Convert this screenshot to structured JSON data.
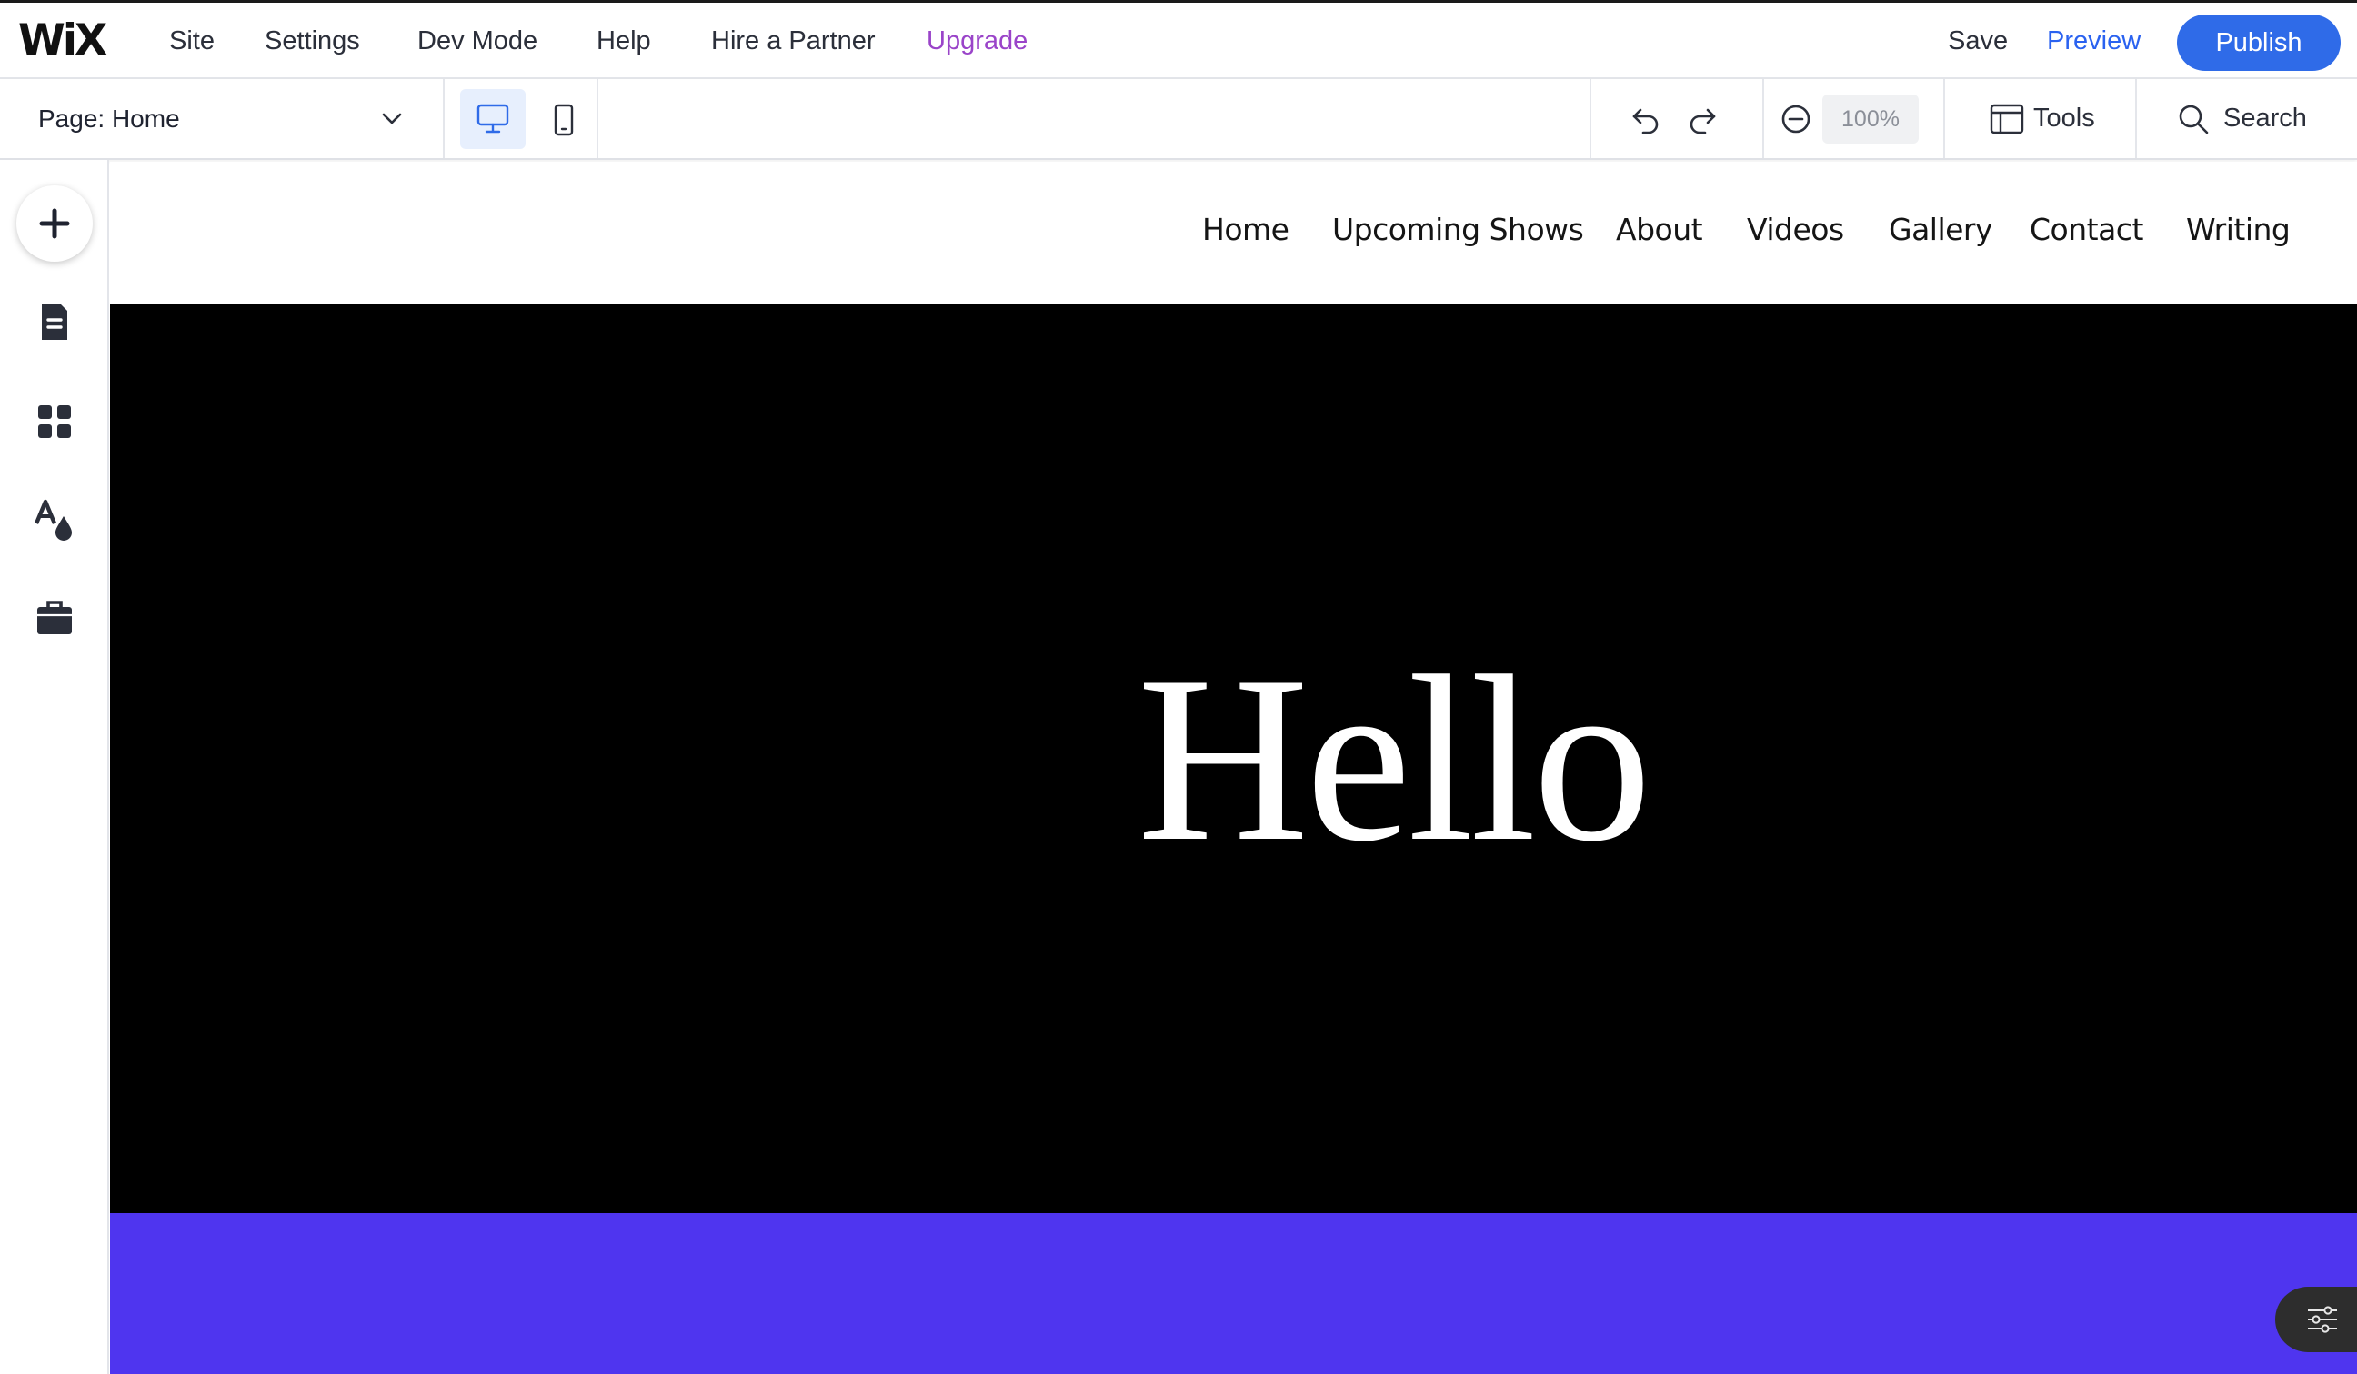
{
  "topbar": {
    "logo": "WiX",
    "menu": [
      "Site",
      "Settings",
      "Dev Mode",
      "Help",
      "Hire a Partner"
    ],
    "upgrade": "Upgrade",
    "save": "Save",
    "preview": "Preview",
    "publish": "Publish"
  },
  "toolbar": {
    "page_label": "Page:",
    "page_value": "Home",
    "zoom": "100%",
    "tools": "Tools",
    "search": "Search"
  },
  "leftrail": {
    "icons": [
      "add-icon",
      "pages-icon",
      "apps-icon",
      "design-icon",
      "business-icon"
    ]
  },
  "site": {
    "nav": [
      "Home",
      "Upcoming Shows",
      "About",
      "Videos",
      "Gallery",
      "Contact",
      "Writing"
    ],
    "hero_title": "Hello"
  },
  "colors": {
    "accent": "#2f6be8",
    "upgrade": "#9a44c9",
    "hero_bg": "#000000",
    "strip_bg": "#4f35ef"
  }
}
